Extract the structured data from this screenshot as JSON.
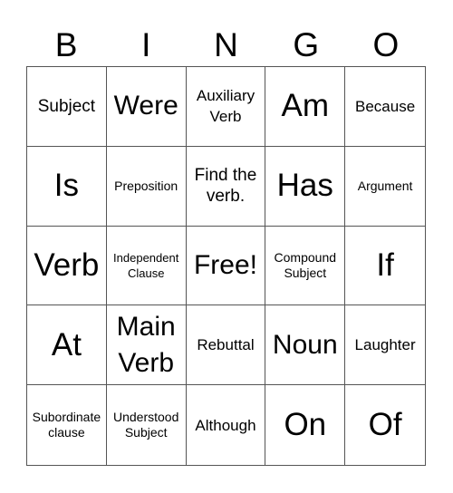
{
  "header": [
    "B",
    "I",
    "N",
    "G",
    "O"
  ],
  "cells": [
    {
      "text": "Subject",
      "size": "md"
    },
    {
      "text": "Were",
      "size": "lg"
    },
    {
      "text": "Auxiliary Verb",
      "size": "md2"
    },
    {
      "text": "Am",
      "size": "xl"
    },
    {
      "text": "Because",
      "size": "md2"
    },
    {
      "text": "Is",
      "size": "xl"
    },
    {
      "text": "Preposition",
      "size": "sm"
    },
    {
      "text": "Find the verb.",
      "size": "md"
    },
    {
      "text": "Has",
      "size": "xl"
    },
    {
      "text": "Argument",
      "size": "sm"
    },
    {
      "text": "Verb",
      "size": "xl"
    },
    {
      "text": "Independent Clause",
      "size": "xs"
    },
    {
      "text": "Free!",
      "size": "lg"
    },
    {
      "text": "Compound Subject",
      "size": "sm"
    },
    {
      "text": "If",
      "size": "xl"
    },
    {
      "text": "At",
      "size": "xl"
    },
    {
      "text": "Main Verb",
      "size": "lg"
    },
    {
      "text": "Rebuttal",
      "size": "md2"
    },
    {
      "text": "Noun",
      "size": "lg"
    },
    {
      "text": "Laughter",
      "size": "md2"
    },
    {
      "text": "Subordinate clause",
      "size": "sm"
    },
    {
      "text": "Understood Subject",
      "size": "sm"
    },
    {
      "text": "Although",
      "size": "md2"
    },
    {
      "text": "On",
      "size": "xl"
    },
    {
      "text": "Of",
      "size": "xl"
    }
  ]
}
